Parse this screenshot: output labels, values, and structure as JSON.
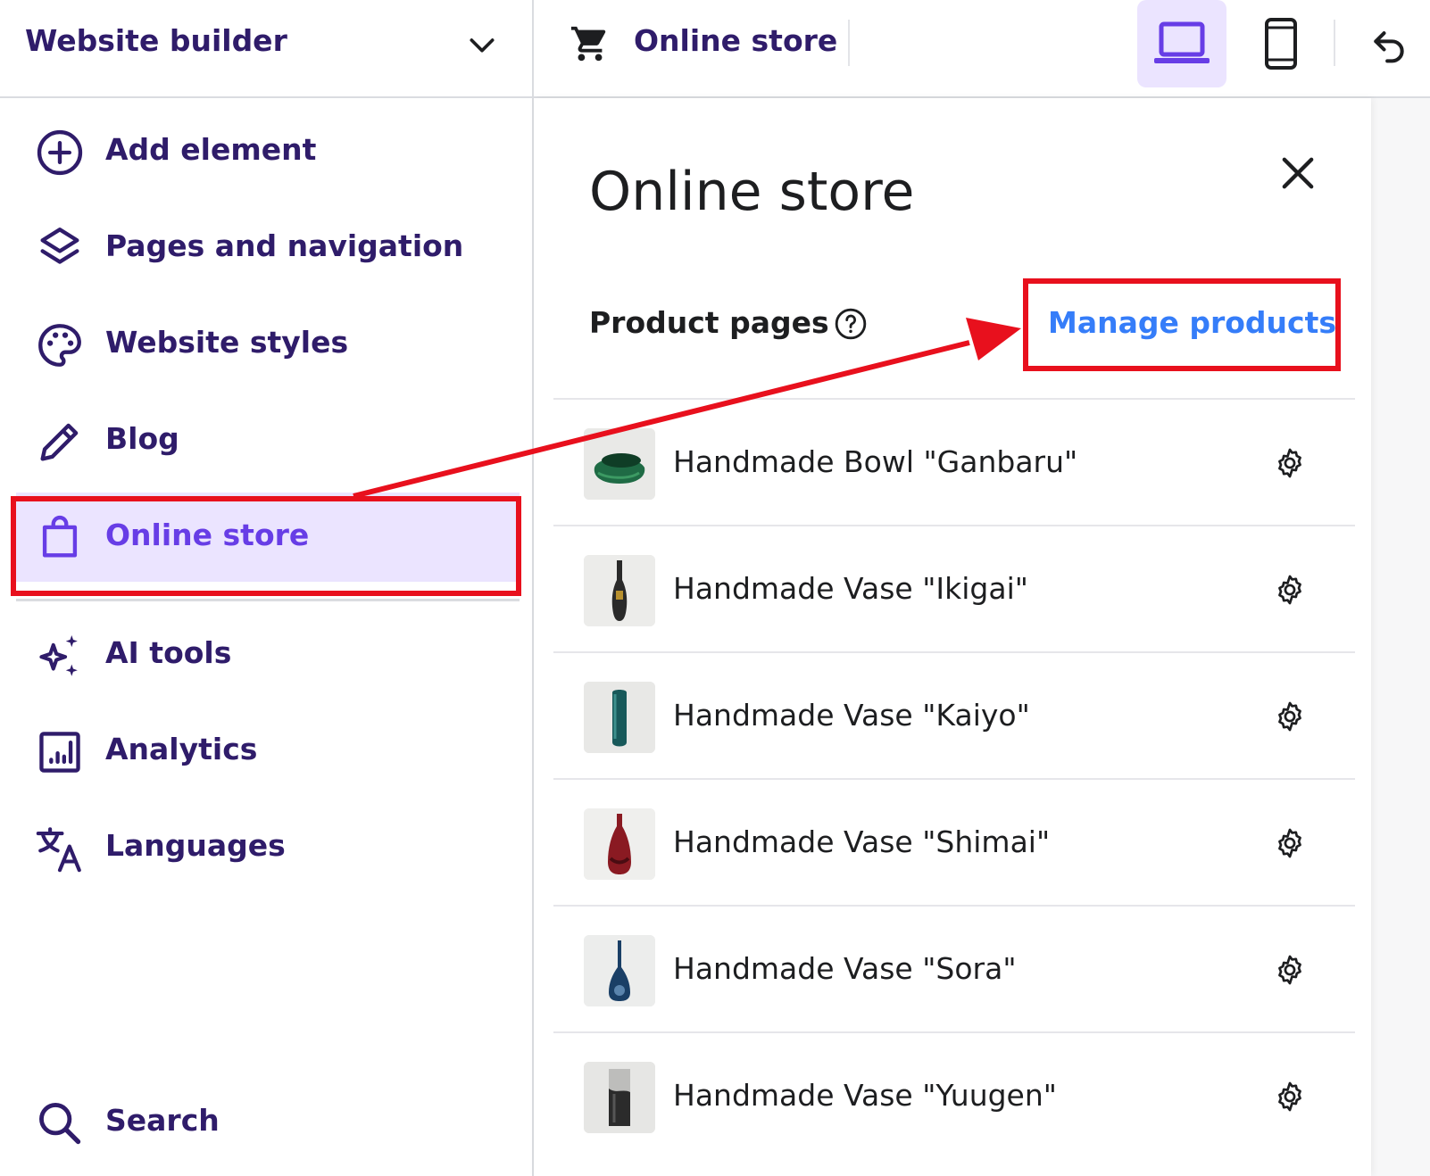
{
  "header": {
    "app_title": "Website builder",
    "current_section": "Online store",
    "device_modes": [
      "laptop-icon",
      "mobile-icon"
    ],
    "active_device": "laptop-icon"
  },
  "sidebar": {
    "items": [
      {
        "label": "Add element",
        "icon": "plus-circle-icon"
      },
      {
        "label": "Pages and navigation",
        "icon": "layers-icon"
      },
      {
        "label": "Website styles",
        "icon": "palette-icon"
      },
      {
        "label": "Blog",
        "icon": "pencil-icon"
      },
      {
        "label": "Online store",
        "icon": "shopping-bag-icon",
        "active": true
      },
      {
        "label": "AI tools",
        "icon": "sparkles-icon"
      },
      {
        "label": "Analytics",
        "icon": "chart-icon"
      },
      {
        "label": "Languages",
        "icon": "translate-icon"
      }
    ],
    "search_label": "Search"
  },
  "panel": {
    "title": "Online store",
    "section_title": "Product pages",
    "manage_link": "Manage products",
    "products": [
      {
        "name": "Handmade Bowl \"Ganbaru\"",
        "thumb": "bowl"
      },
      {
        "name": "Handmade Vase \"Ikigai\"",
        "thumb": "vase-dark"
      },
      {
        "name": "Handmade Vase \"Kaiyo\"",
        "thumb": "vase-teal"
      },
      {
        "name": "Handmade Vase \"Shimai\"",
        "thumb": "vase-red"
      },
      {
        "name": "Handmade Vase \"Sora\"",
        "thumb": "vase-blue"
      },
      {
        "name": "Handmade Vase \"Yuugen\"",
        "thumb": "vase-gray"
      }
    ]
  },
  "colors": {
    "brand_purple": "#673de6",
    "nav_text": "#2f1c6a",
    "active_bg": "#ebe4ff",
    "link_blue": "#357df9",
    "annotation_red": "#e8101d"
  }
}
